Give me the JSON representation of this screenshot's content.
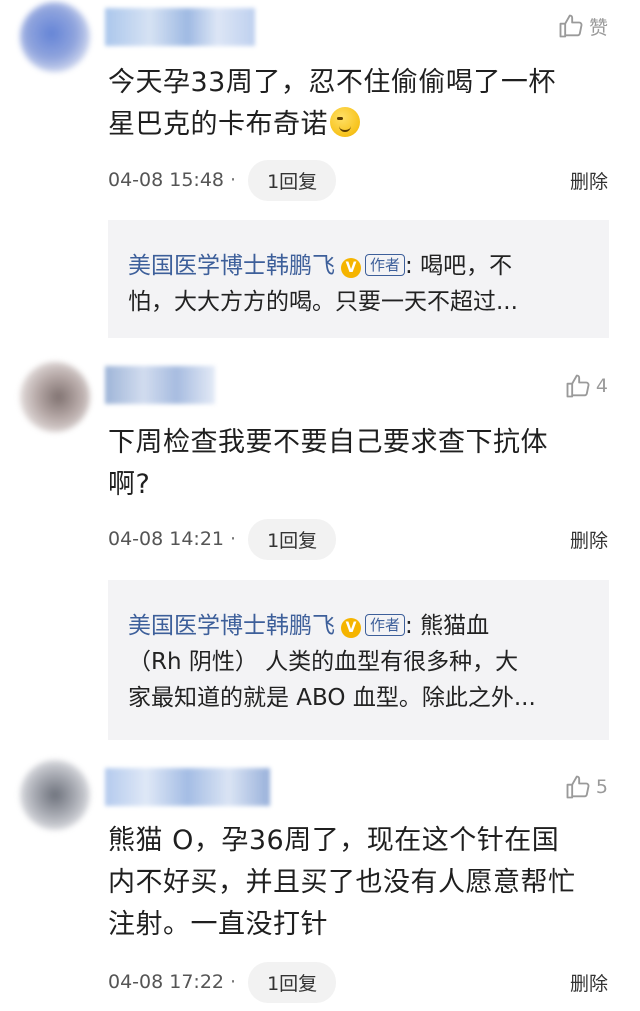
{
  "comments": [
    {
      "like_label": "赞",
      "text_line1": "今天孕33周了，忍不住偷偷喝了一杯",
      "text_line2": "星巴克的卡布奇诺",
      "time": "04-08 15:48",
      "reply_label": "1回复",
      "delete_label": "删除",
      "reply": {
        "author": "美国医学博士韩鹏飞",
        "badge": "V",
        "tag": "作者",
        "line1": ": 喝吧，不",
        "line2": "怕，大大方方的喝。只要一天不超过..."
      }
    },
    {
      "like_count": "4",
      "text_line1": "下周检查我要不要自己要求查下抗体",
      "text_line2": "啊?",
      "time": "04-08 14:21",
      "reply_label": "1回复",
      "delete_label": "删除",
      "reply": {
        "author": "美国医学博士韩鹏飞",
        "badge": "V",
        "tag": "作者",
        "line1": ": 熊猫血",
        "line2": "（Rh 阴性） 人类的血型有很多种，大",
        "line3": "家最知道的就是 ABO 血型。除此之外..."
      }
    },
    {
      "like_count": "5",
      "text_line1": "熊猫 O，孕36周了，现在这个针在国",
      "text_line2": "内不好买，并且买了也没有人愿意帮忙",
      "text_line3": "注射。一直没打针",
      "time": "04-08 17:22",
      "reply_label": "1回复",
      "delete_label": "删除"
    }
  ],
  "colors": {
    "author": "#3d5f9a",
    "badge": "#f5b400",
    "reply_bg": "#f3f3f5"
  },
  "icons": {
    "like": "thumbs-up-icon",
    "emoji": "smirk-emoji-icon",
    "verified": "verified-badge-icon"
  },
  "meta_separator": "·"
}
